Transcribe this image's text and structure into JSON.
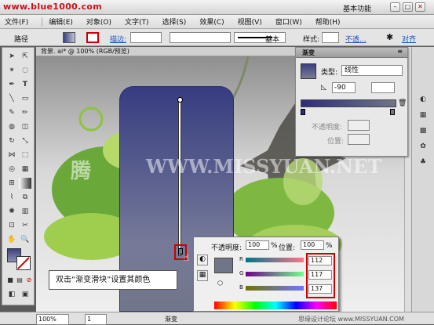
{
  "watermark_site": "www.blue1000.com",
  "window": {
    "workspace": "基本功能"
  },
  "menu": [
    "文件(F)",
    "编辑(E)",
    "对象(O)",
    "文字(T)",
    "选择(S)",
    "效果(C)",
    "视图(V)",
    "窗口(W)",
    "帮助(H)"
  ],
  "control": {
    "object_label": "路径",
    "stroke_label": "描边:",
    "brush_label": "基本",
    "style_label": "样式:",
    "opacity_label": "不透...",
    "align_label": "对齐"
  },
  "document_tab": "背景. ai* @ 100% (RGB/预览)",
  "gradient_panel": {
    "title": "渐变",
    "type_label": "类型:",
    "type_value": "线性",
    "angle": "-90",
    "opacity_label": "不透明度:",
    "location_label": "位置:"
  },
  "popup": {
    "opacity_label": "不透明度:",
    "opacity_value": "100",
    "percent": "%",
    "location_label": "位置:",
    "location_value": "100",
    "channels": [
      {
        "label": "R",
        "value": "112"
      },
      {
        "label": "G",
        "value": "117"
      },
      {
        "label": "B",
        "value": "137"
      }
    ]
  },
  "callout": "双击“渐变滑块”设置其颜色",
  "canvas_watermark": "WWW.MISSYUAN.NET",
  "canvas_watermark_cn": "腾",
  "status": {
    "zoom": "100%",
    "page": "1",
    "tool": "渐变"
  },
  "footer_watermark": "思缘设计论坛 www.MISSYUAN.COM",
  "colors": {
    "selected_stop": "#707589",
    "red_highlight": "#cc0000"
  }
}
